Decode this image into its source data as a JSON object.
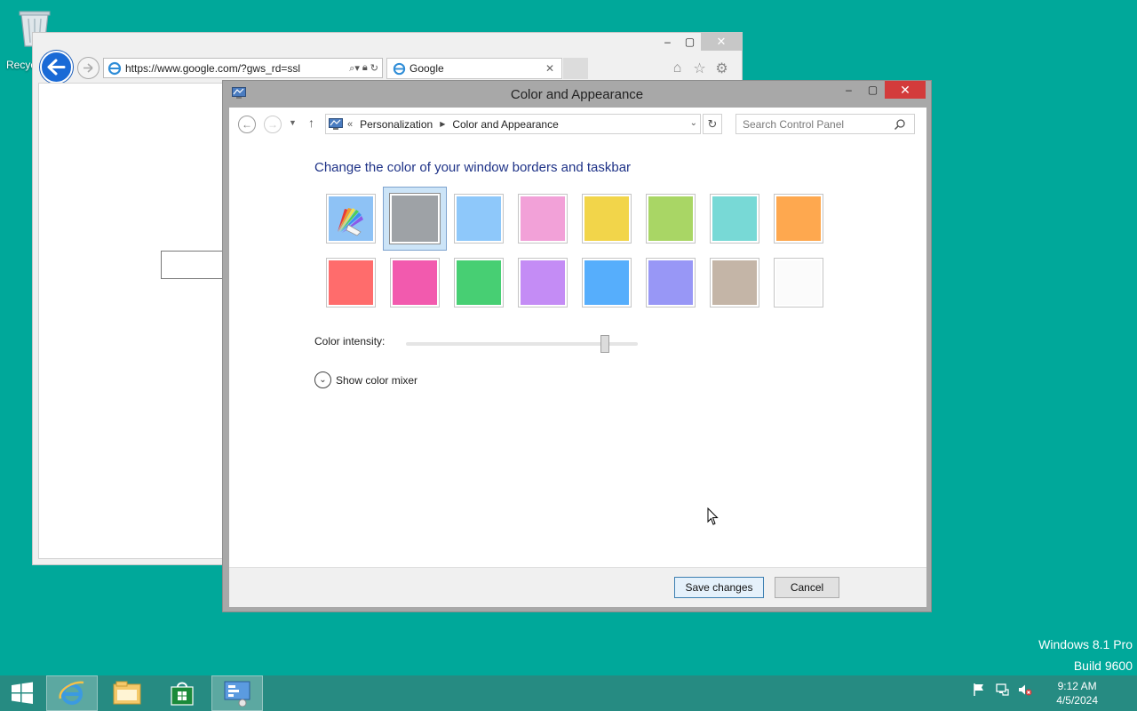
{
  "desktop": {
    "recycle_bin_label": "Recyc",
    "watermark_line1": "Windows 8.1 Pro",
    "watermark_line2": "Build 9600"
  },
  "browser": {
    "address_url": "https://www.google.com/?gws_rd=ssl",
    "tab_title": "Google",
    "minimize_glyph": "–",
    "maximize_glyph": "▢",
    "close_glyph": "✕",
    "tab_close_glyph": "✕"
  },
  "control_panel": {
    "window_title": "Color and Appearance",
    "breadcrumb_prefix": "«",
    "breadcrumb": [
      "Personalization",
      "Color and Appearance"
    ],
    "search_placeholder": "Search Control Panel",
    "heading": "Change the color of your window borders and taskbar",
    "swatches_row1": [
      {
        "name": "automatic",
        "color": "auto"
      },
      {
        "name": "gray",
        "color": "#9ea2a6",
        "selected": true
      },
      {
        "name": "light-blue",
        "color": "#8ec8fa"
      },
      {
        "name": "pink",
        "color": "#f2a1d8"
      },
      {
        "name": "yellow",
        "color": "#f2d54a"
      },
      {
        "name": "lime",
        "color": "#a9d665"
      },
      {
        "name": "teal",
        "color": "#78d9d6"
      },
      {
        "name": "orange",
        "color": "#fea84f"
      }
    ],
    "swatches_row2": [
      {
        "name": "red",
        "color": "#ff6c6c"
      },
      {
        "name": "magenta",
        "color": "#f25aae"
      },
      {
        "name": "green",
        "color": "#47cf73"
      },
      {
        "name": "purple",
        "color": "#c48cf5"
      },
      {
        "name": "blue",
        "color": "#56aefc"
      },
      {
        "name": "periwinkle",
        "color": "#9897f6"
      },
      {
        "name": "taupe",
        "color": "#c4b5a7"
      },
      {
        "name": "white",
        "color": "#fbfbfb"
      }
    ],
    "intensity_label": "Color intensity:",
    "intensity_value": 0.86,
    "show_mixer_label": "Show color mixer",
    "save_button": "Save changes",
    "cancel_button": "Cancel"
  },
  "taskbar": {
    "time": "9:12 AM",
    "date": "4/5/2024"
  },
  "colors": {
    "desktop": "#00a89a",
    "taskbar": "#268b82",
    "heading": "#1e3287",
    "close_red": "#d33b3b"
  }
}
